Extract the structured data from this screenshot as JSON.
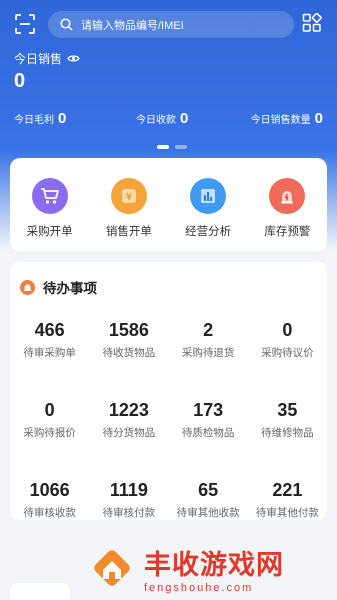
{
  "search": {
    "placeholder": "请输入物品编号/IMEI"
  },
  "summary": {
    "sales_label": "今日销售",
    "sales_value": "0",
    "gross_profit_label": "今日毛利",
    "gross_profit_value": "0",
    "receipts_label": "今日收款",
    "receipts_value": "0",
    "sales_qty_label": "今日销售数量",
    "sales_qty_value": "0"
  },
  "quick_actions": [
    {
      "label": "采购开单",
      "icon": "shopping-cart-icon",
      "color": "#8a6cf0"
    },
    {
      "label": "销售开单",
      "icon": "sales-order-icon",
      "color": "#f5a33a"
    },
    {
      "label": "经营分析",
      "icon": "bar-chart-icon",
      "color": "#3f9bf2"
    },
    {
      "label": "库存预警",
      "icon": "alarm-icon",
      "color": "#f06a5a"
    }
  ],
  "todo": {
    "title": "待办事项",
    "items": [
      {
        "value": "466",
        "label": "待审采购单"
      },
      {
        "value": "1586",
        "label": "待收货物品"
      },
      {
        "value": "2",
        "label": "采购待退货"
      },
      {
        "value": "0",
        "label": "采购待议价"
      },
      {
        "value": "0",
        "label": "采购待报价"
      },
      {
        "value": "1223",
        "label": "待分货物品"
      },
      {
        "value": "173",
        "label": "待质检物品"
      },
      {
        "value": "35",
        "label": "待维修物品"
      },
      {
        "value": "1066",
        "label": "待审核收款"
      },
      {
        "value": "1119",
        "label": "待审核付款"
      },
      {
        "value": "65",
        "label": "待审其他收款"
      },
      {
        "value": "221",
        "label": "待审其他付款"
      }
    ]
  },
  "watermark": {
    "title": "丰收游戏网",
    "subtitle": "fengshouhe.com"
  }
}
